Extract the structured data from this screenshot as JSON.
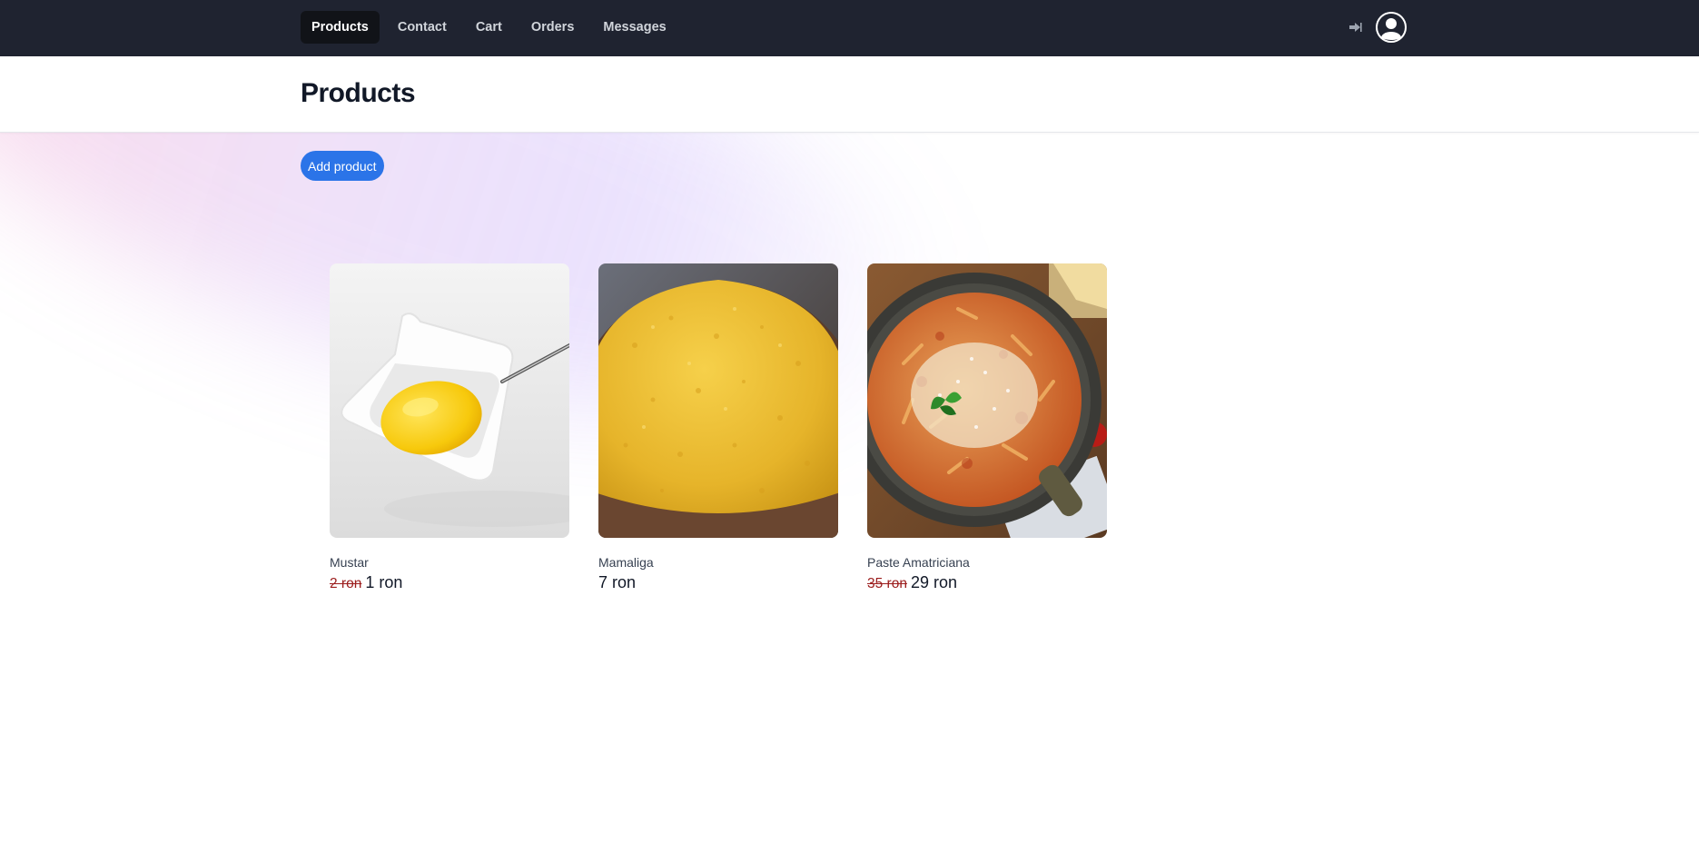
{
  "nav": {
    "items": [
      {
        "label": "Products",
        "active": true
      },
      {
        "label": "Contact",
        "active": false
      },
      {
        "label": "Cart",
        "active": false
      },
      {
        "label": "Orders",
        "active": false
      },
      {
        "label": "Messages",
        "active": false
      }
    ],
    "logout_icon": "logout-icon",
    "avatar_icon": "user-avatar-icon"
  },
  "header": {
    "title": "Products"
  },
  "actions": {
    "add_label": "Add product"
  },
  "products": [
    {
      "name": "Mustar",
      "old_price": "2 ron",
      "price": "1 ron",
      "image": "mustard-bowl"
    },
    {
      "name": "Mamaliga",
      "old_price": "",
      "price": "7 ron",
      "image": "polenta"
    },
    {
      "name": "Paste Amatriciana",
      "old_price": "35 ron",
      "price": "29 ron",
      "image": "pasta-pan"
    }
  ],
  "colors": {
    "navbar_bg": "#1f2330",
    "active_nav_bg": "#111318",
    "accent": "#2b74e8",
    "old_price": "#9b1c1c"
  }
}
